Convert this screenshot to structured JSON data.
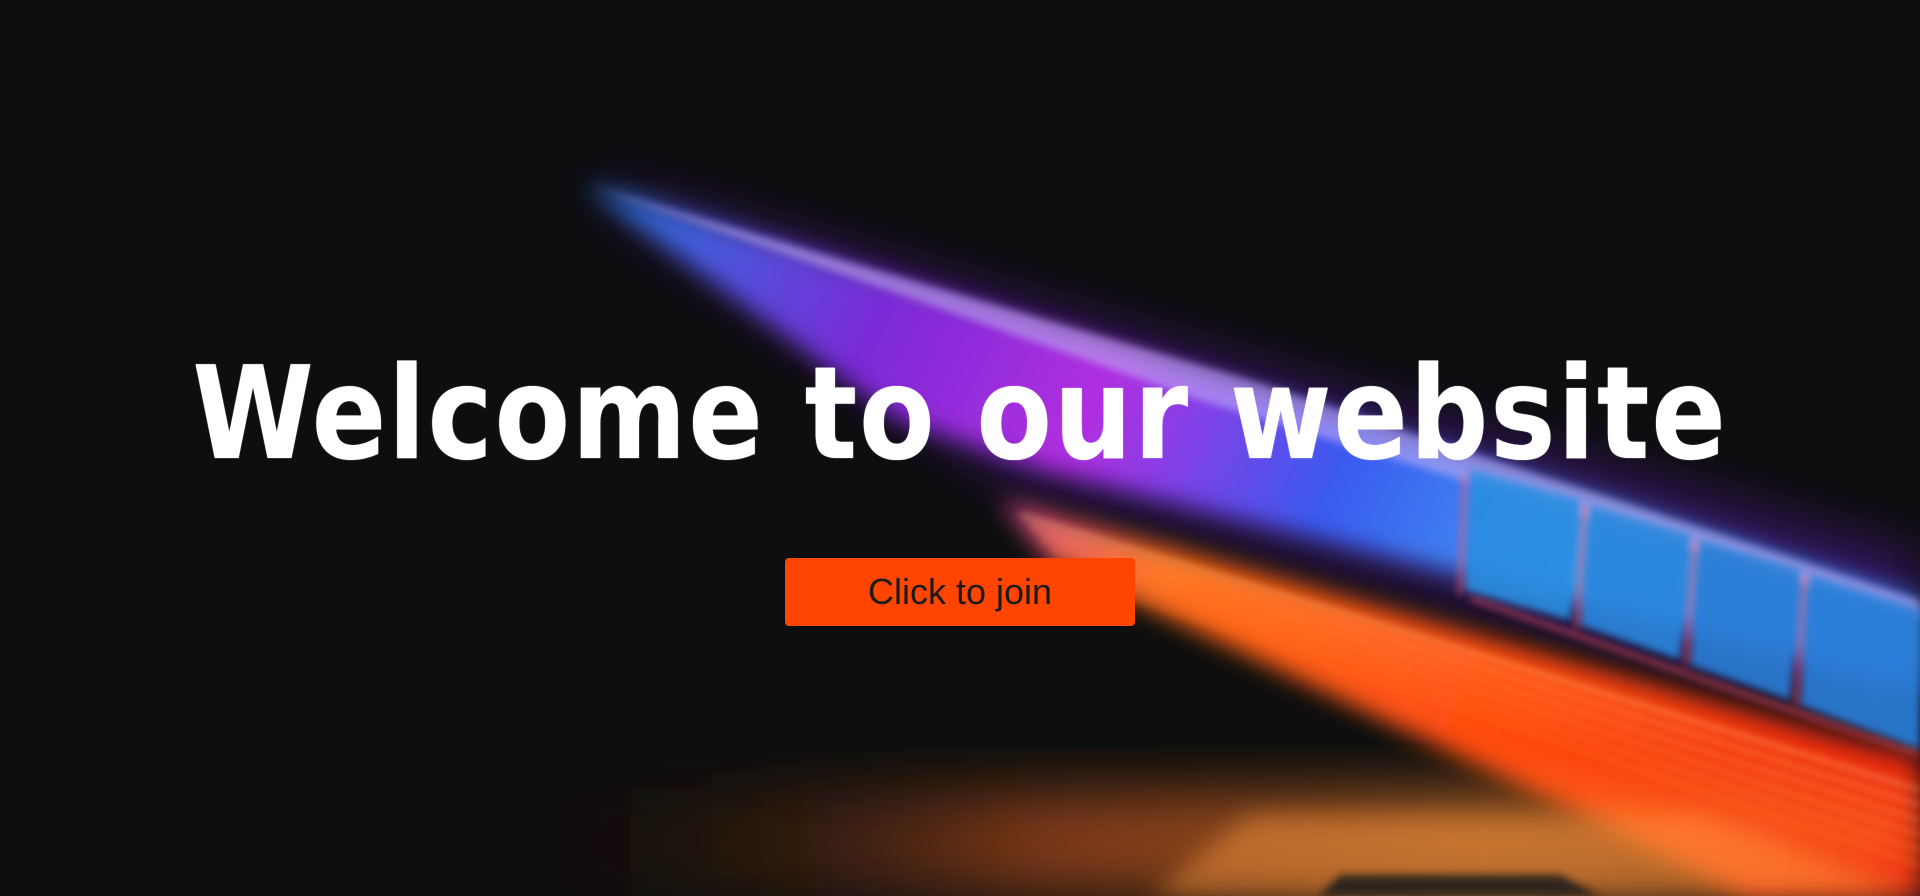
{
  "hero": {
    "title": "Welcome to our website",
    "cta_label": "Click to join",
    "background_image": "blurred-laptop-neon-photo"
  },
  "colors": {
    "background": "#0d0e0e",
    "title": "#ffffff",
    "button": "#ff4500",
    "button_text": "#1b1b1b"
  }
}
